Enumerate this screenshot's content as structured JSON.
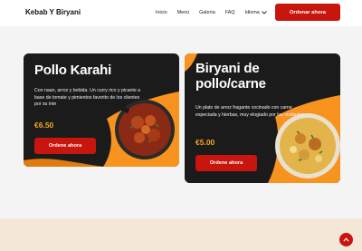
{
  "header": {
    "logo": "Kebab Y Biryani",
    "nav": [
      "Inicio",
      "Menú",
      "Galería",
      "FAQ",
      "Idioma"
    ],
    "order_label": "Ordenar ahora"
  },
  "cards": [
    {
      "title_lines": [
        "Pollo Karahi"
      ],
      "description": "Con naan, arroz y bebida. Un curry rico y picante a base de tomate y pimientos favorito de los clientes por su inte",
      "price": "€6.50",
      "button_label": "Ordene ahora"
    },
    {
      "title_lines": [
        "Biryani de",
        "pollo/carne"
      ],
      "description": "Un plato de arroz fragante cocinado con carne especiada y hierbas, muy elogiado por los visitantes.",
      "price": "€5.00",
      "button_label": "Ordene ahora"
    }
  ],
  "colors": {
    "accent": "#c8150e",
    "orange": "#f7931e",
    "price": "#f5a623",
    "card_bg": "#1b1b1b",
    "footer": "#f3e8d7"
  },
  "icons": {
    "idioma_chevron": "chevron-down-icon",
    "scroll_top": "arrow-up-icon"
  }
}
